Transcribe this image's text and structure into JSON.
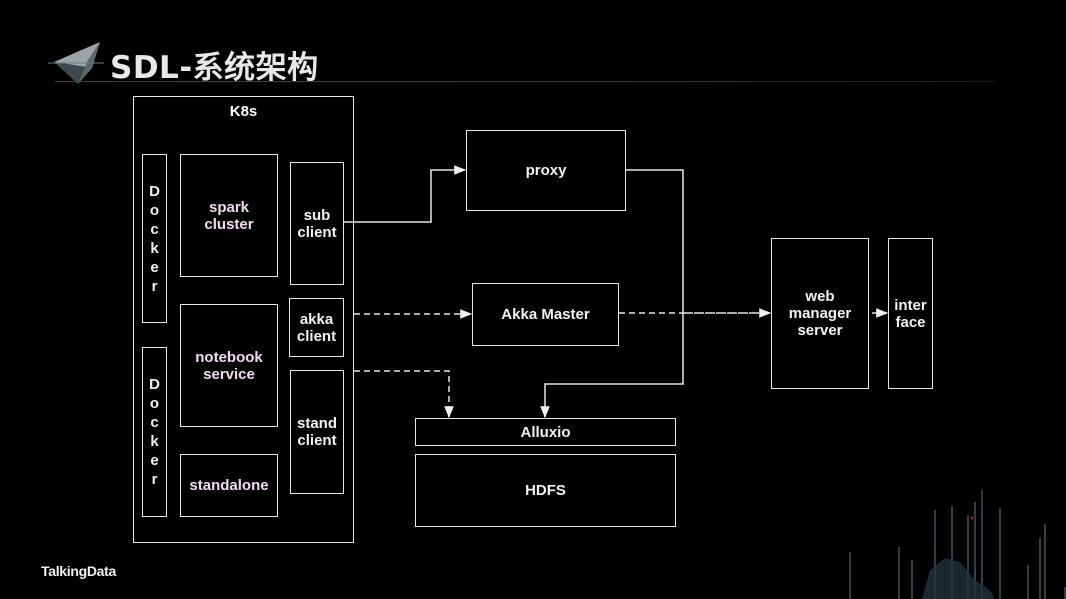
{
  "slide": {
    "title": "SDL-系统架构",
    "footer_brand": "TalkingData"
  },
  "diagram": {
    "k8s": {
      "label": "K8s"
    },
    "docker_top": {
      "label": "Docker",
      "letters": [
        "D",
        "o",
        "c",
        "k",
        "e",
        "r"
      ]
    },
    "docker_bottom": {
      "label": "Docker",
      "letters": [
        "D",
        "o",
        "c",
        "k",
        "e",
        "r"
      ]
    },
    "spark_cluster": {
      "line1": "spark",
      "line2": "cluster"
    },
    "notebook_service": {
      "line1": "notebook",
      "line2": "service"
    },
    "standalone": {
      "line1": "standalone"
    },
    "sub_client": {
      "line1": "sub",
      "line2": "client"
    },
    "akka_client": {
      "line1": "akka",
      "line2": "client"
    },
    "stand_client": {
      "line1": "stand",
      "line2": "client"
    },
    "proxy": {
      "label": "proxy"
    },
    "akka_master": {
      "label": "Akka Master"
    },
    "alluxio": {
      "label": "Alluxio"
    },
    "hdfs": {
      "label": "HDFS"
    },
    "web_manager_server": {
      "line1": "web",
      "line2": "manager",
      "line3": "server"
    },
    "interface": {
      "line1": "inter",
      "line2": "face"
    },
    "edges": [
      {
        "from": "sub client",
        "to": "proxy",
        "style": "solid"
      },
      {
        "from": "proxy",
        "to": "Alluxio",
        "style": "solid"
      },
      {
        "from": "akka client",
        "to": "Akka Master",
        "style": "dashed"
      },
      {
        "from": "Akka Master",
        "to": "web manager server",
        "style": "dashed"
      },
      {
        "from": "stand client",
        "to": "Alluxio",
        "style": "dashed"
      },
      {
        "from": "web manager server",
        "to": "interface",
        "style": "solid"
      }
    ]
  },
  "colors": {
    "background": "#000000",
    "stroke": "#e6e6e6",
    "label_pink": "#f0dcf0"
  }
}
